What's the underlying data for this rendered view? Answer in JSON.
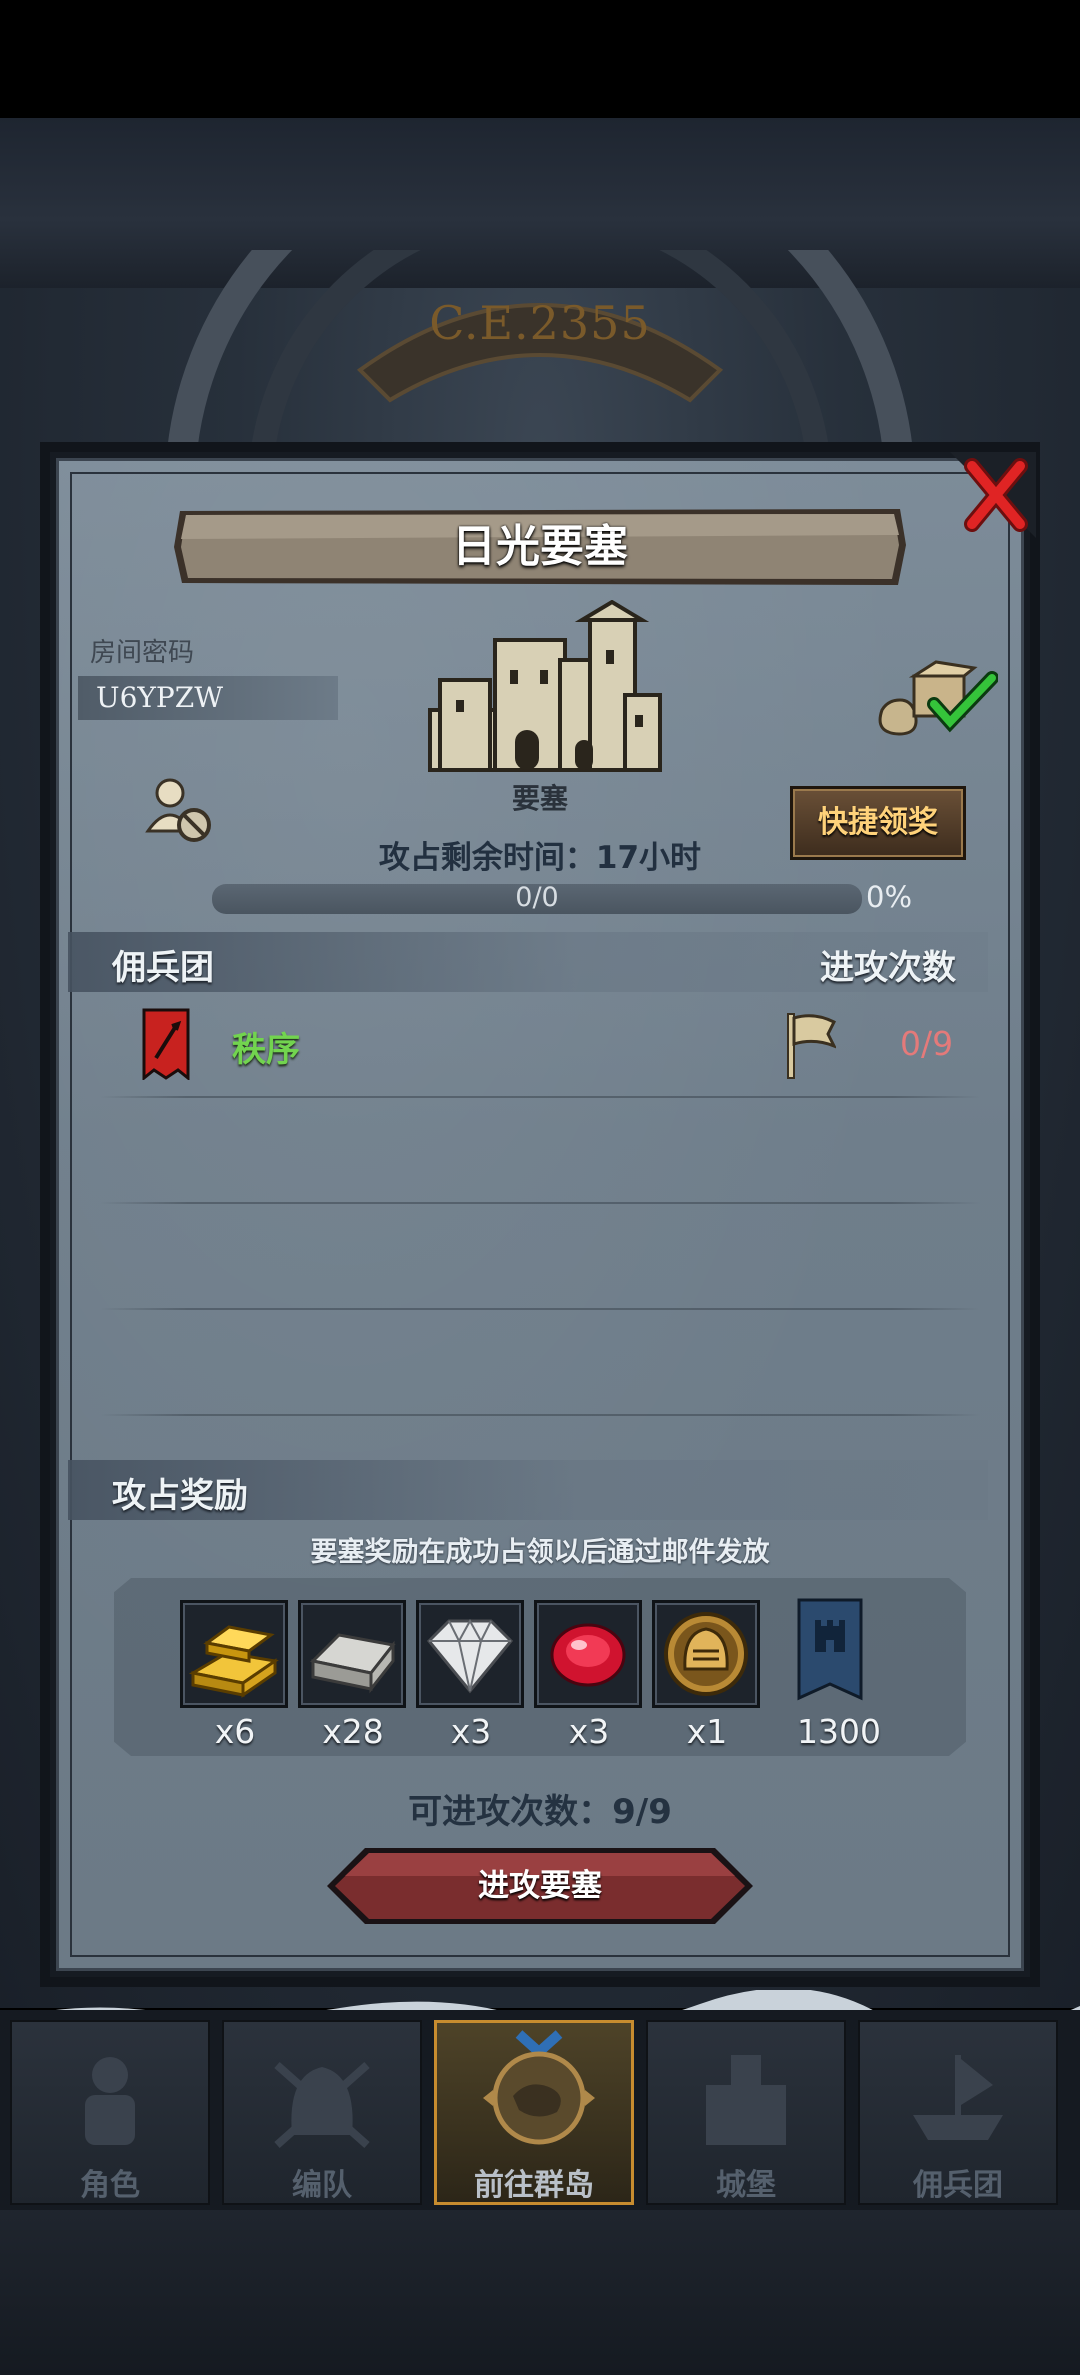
{
  "background": {
    "era_label": "C.E.2355"
  },
  "dialog": {
    "title": "日光要塞",
    "room_code_label": "房间密码",
    "room_code": "U6YPZW",
    "fortress_type": "要塞",
    "remaining_time": "攻占剩余时间：17小时",
    "quick_claim_label": "快捷领奖",
    "progress_text": "0/0",
    "progress_percent_text": "0%",
    "progress_fraction": 0,
    "table_header_left": "佣兵团",
    "table_header_right": "进攻次数",
    "rows": [
      {
        "guild": "秩序",
        "attacks": "0/9"
      }
    ],
    "rewards_title": "攻占奖励",
    "reward_note": "要塞奖励在成功占领以后通过邮件发放",
    "rewards": [
      {
        "icon": "gold-bars-icon",
        "qty": "x6"
      },
      {
        "icon": "iron-ingot-icon",
        "qty": "x28"
      },
      {
        "icon": "diamond-icon",
        "qty": "x3"
      },
      {
        "icon": "ruby-icon",
        "qty": "x3"
      },
      {
        "icon": "knight-helmet-coin-icon",
        "qty": "x1"
      },
      {
        "icon": "fortress-banner-icon",
        "qty": "1300"
      }
    ],
    "attempts_text": "可进攻次数：9/9",
    "attack_button_label": "进攻要塞"
  },
  "nav": {
    "items": [
      {
        "label": "角色",
        "icon": "knight-icon"
      },
      {
        "label": "编队",
        "icon": "helmet-swords-icon"
      },
      {
        "label": "前往群岛",
        "icon": "island-map-icon",
        "active": true
      },
      {
        "label": "城堡",
        "icon": "castle-icon"
      },
      {
        "label": "佣兵团",
        "icon": "ship-icon"
      }
    ]
  },
  "colors": {
    "guild_name": "#72d44f",
    "attack_count": "#e47a7a",
    "quick_claim_text": "#ffd27a",
    "active_nav_border": "#c78c2f"
  }
}
